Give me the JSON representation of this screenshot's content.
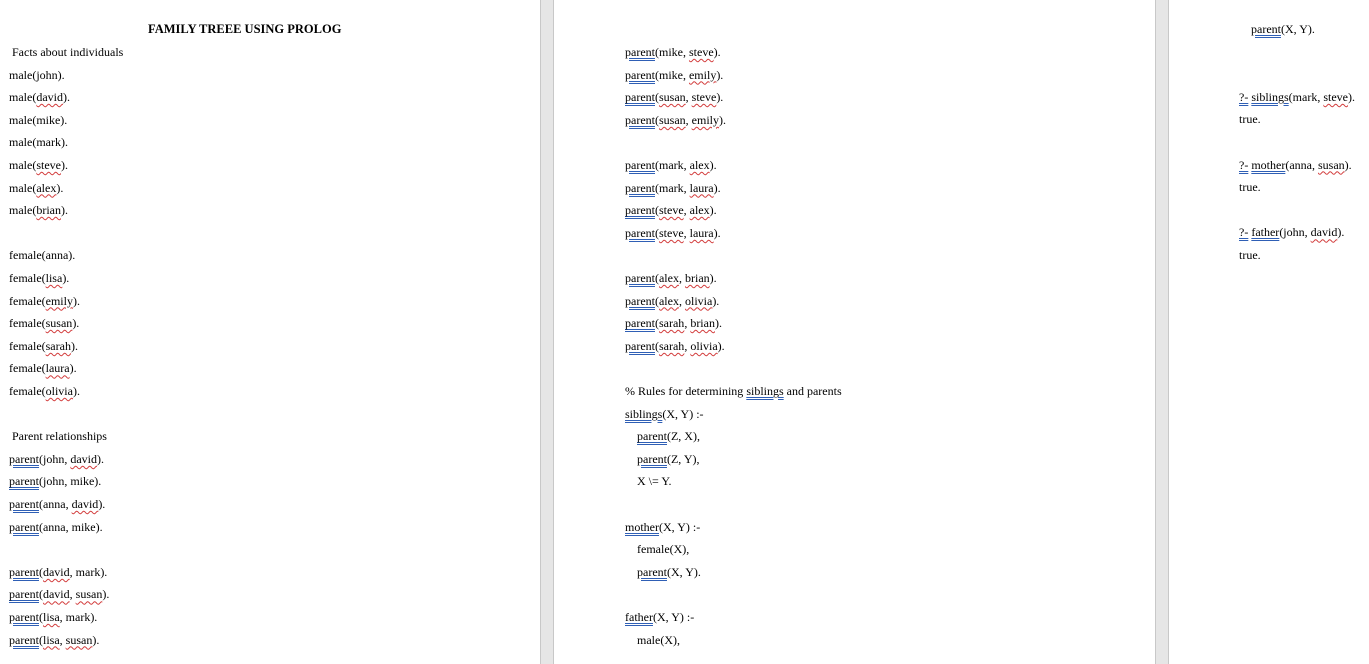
{
  "page1": {
    "title": "FAMILY TREEE USING PROLOG",
    "lines": [
      " Facts about individuals",
      "male(john).",
      "male(david).",
      "male(mike).",
      "male(mark).",
      "male(steve).",
      "male(alex).",
      "male(brian).",
      "",
      "female(anna).",
      "female(lisa).",
      "female(emily).",
      "female(susan).",
      "female(sarah).",
      "female(laura).",
      "female(olivia).",
      "",
      " Parent relationships",
      "parent(john, david).",
      "parent(john, mike).",
      "parent(anna, david).",
      "parent(anna, mike).",
      "",
      "parent(david, mark).",
      "parent(david, susan).",
      "parent(lisa, mark).",
      "parent(lisa, susan)."
    ]
  },
  "page2": {
    "lines": [
      "parent(mike, steve).",
      "parent(mike, emily).",
      "parent(susan, steve).",
      "parent(susan, emily).",
      "",
      "parent(mark, alex).",
      "parent(mark, laura).",
      "parent(steve, alex).",
      "parent(steve, laura).",
      "",
      "parent(alex, brian).",
      "parent(alex, olivia).",
      "parent(sarah, brian).",
      "parent(sarah, olivia).",
      "",
      "% Rules for determining siblings and parents",
      "siblings(X, Y) :-",
      "    parent(Z, X),",
      "    parent(Z, Y),",
      "    X \\= Y.",
      "",
      "mother(X, Y) :-",
      "    female(X),",
      "    parent(X, Y).",
      "",
      "father(X, Y) :-",
      "    male(X),"
    ]
  },
  "page3": {
    "lines": [
      "    parent(X, Y).",
      "",
      "",
      "?- siblings(mark, steve).",
      "true.",
      "",
      "?- mother(anna, susan).",
      "true.",
      "",
      "?- father(john, david).",
      "true."
    ]
  }
}
